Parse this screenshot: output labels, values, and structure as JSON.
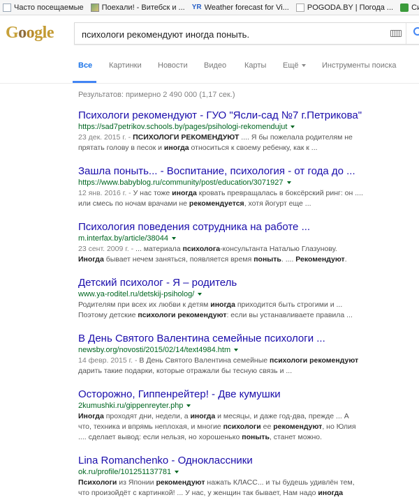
{
  "bookmarks": [
    {
      "label": "Часто посещаемые",
      "icon": "page-icon"
    },
    {
      "label": "Поехали! - Витебск и ...",
      "icon": "image-icon"
    },
    {
      "label": "YR",
      "icon": "yr-icon"
    },
    {
      "label": "Weather forecast for Vi...",
      "icon": "none"
    },
    {
      "label": "POGODA.BY | Погода ...",
      "icon": "page-icon"
    },
    {
      "label": "Система «Интернет",
      "icon": "rss-icon"
    }
  ],
  "search": {
    "query": "психологи рекомендуют иногда поныть."
  },
  "tabs": {
    "all": "Все",
    "images": "Картинки",
    "news": "Новости",
    "video": "Видео",
    "maps": "Карты",
    "more": "Ещё",
    "tools": "Инструменты поиска"
  },
  "stats": "Результатов: примерно 2 490 000 (1,17 сек.)",
  "results": [
    {
      "title": "Психологи рекомендуют - ГУО \"Ясли-сад №7 г.Петрикова\"",
      "url": "https://sad7petrikov.schools.by/pages/psihologi-rekomendujut",
      "snippet": [
        [
          {
            "t": "23 дек. 2015 г. - ",
            "c": "date"
          },
          {
            "t": "ПСИХОЛОГИ РЕКОМЕНДУЮТ",
            "c": "b"
          },
          {
            "t": " .... Я бы пожелала родителям не"
          }
        ],
        [
          {
            "t": "прятать голову в песок и "
          },
          {
            "t": "иногда",
            "c": "b"
          },
          {
            "t": " относиться к своему ребенку, как к ..."
          }
        ]
      ]
    },
    {
      "title": "Зашла поныть... - Воспитание, психология - от года до ...",
      "url": "https://www.babyblog.ru/community/post/education/3071927",
      "snippet": [
        [
          {
            "t": "12 янв. 2016 г. - ",
            "c": "date"
          },
          {
            "t": "У нас тоже "
          },
          {
            "t": "иногда",
            "c": "b"
          },
          {
            "t": " кровать превращалась в боксёрский ринг: он ...."
          }
        ],
        [
          {
            "t": "или смесь по ночам врачами не "
          },
          {
            "t": "рекомендуется",
            "c": "b"
          },
          {
            "t": ", хотя йогурт еще ..."
          }
        ]
      ]
    },
    {
      "title": "Психология поведения сотрудника на работе ...",
      "url": "m.interfax.by/article/38044",
      "snippet": [
        [
          {
            "t": "23 сент. 2009 г. - ",
            "c": "date"
          },
          {
            "t": "... материала "
          },
          {
            "t": "психолога",
            "c": "b"
          },
          {
            "t": "-консультанта Наталью Глазунову."
          }
        ],
        [
          {
            "t": "Иногда",
            "c": "b"
          },
          {
            "t": " бывает нечем заняться, появляется время "
          },
          {
            "t": "поныть",
            "c": "b"
          },
          {
            "t": ". .... "
          },
          {
            "t": "Рекомендуют",
            "c": "b"
          },
          {
            "t": "."
          }
        ]
      ]
    },
    {
      "title": "Детский психолог - Я – родитель",
      "url": "www.ya-roditel.ru/detskij-psiholog/",
      "snippet": [
        [
          {
            "t": "Родителям при всех их любви к детям "
          },
          {
            "t": "иногда",
            "c": "b"
          },
          {
            "t": " приходится быть строгими и ..."
          }
        ],
        [
          {
            "t": "Поэтому детские "
          },
          {
            "t": "психологи рекомендуют",
            "c": "b"
          },
          {
            "t": ": если вы устанавливаете правила ..."
          }
        ]
      ]
    },
    {
      "title": "В День Святого Валентина семейные психологи ...",
      "url": "newsby.org/novosti/2015/02/14/text4984.htm",
      "snippet": [
        [
          {
            "t": "14 февр. 2015 г. - ",
            "c": "date"
          },
          {
            "t": "В День Святого Валентина семейные "
          },
          {
            "t": "психологи рекомендуют",
            "c": "b"
          }
        ],
        [
          {
            "t": "дарить такие подарки, которые отражали бы тесную связь и ..."
          }
        ]
      ]
    },
    {
      "title": "Осторожно, Гиппенрейтер! - Две кумушки",
      "url": "2kumushki.ru/gippenreyter.php",
      "snippet": [
        [
          {
            "t": "Иногда",
            "c": "b"
          },
          {
            "t": " проходят дни, недели, а "
          },
          {
            "t": "иногда",
            "c": "b"
          },
          {
            "t": " и месяцы, и даже год-два, прежде ... А"
          }
        ],
        [
          {
            "t": "что, техника и впрямь неплохая, и многие "
          },
          {
            "t": "психологи",
            "c": "b"
          },
          {
            "t": " ее "
          },
          {
            "t": "рекомендуют",
            "c": "b"
          },
          {
            "t": ", но Юлия"
          }
        ],
        [
          {
            "t": ".... сделает вывод: если нельзя, но хорошенько "
          },
          {
            "t": "поныть",
            "c": "b"
          },
          {
            "t": ", станет можно."
          }
        ]
      ]
    },
    {
      "title": "Lina Romanchenko - Одноклассники",
      "url": "ok.ru/profile/101251137781",
      "snippet": [
        [
          {
            "t": "Психологи",
            "c": "b"
          },
          {
            "t": " из Японии "
          },
          {
            "t": "рекомендуют",
            "c": "b"
          },
          {
            "t": " нажать КЛАСС... и ты будешь удивлён тем,"
          }
        ],
        [
          {
            "t": "что произойдёт с картинкой! ... У нас, у женщин так бывает, Нам надо "
          },
          {
            "t": "иногда",
            "c": "b"
          }
        ]
      ]
    }
  ]
}
